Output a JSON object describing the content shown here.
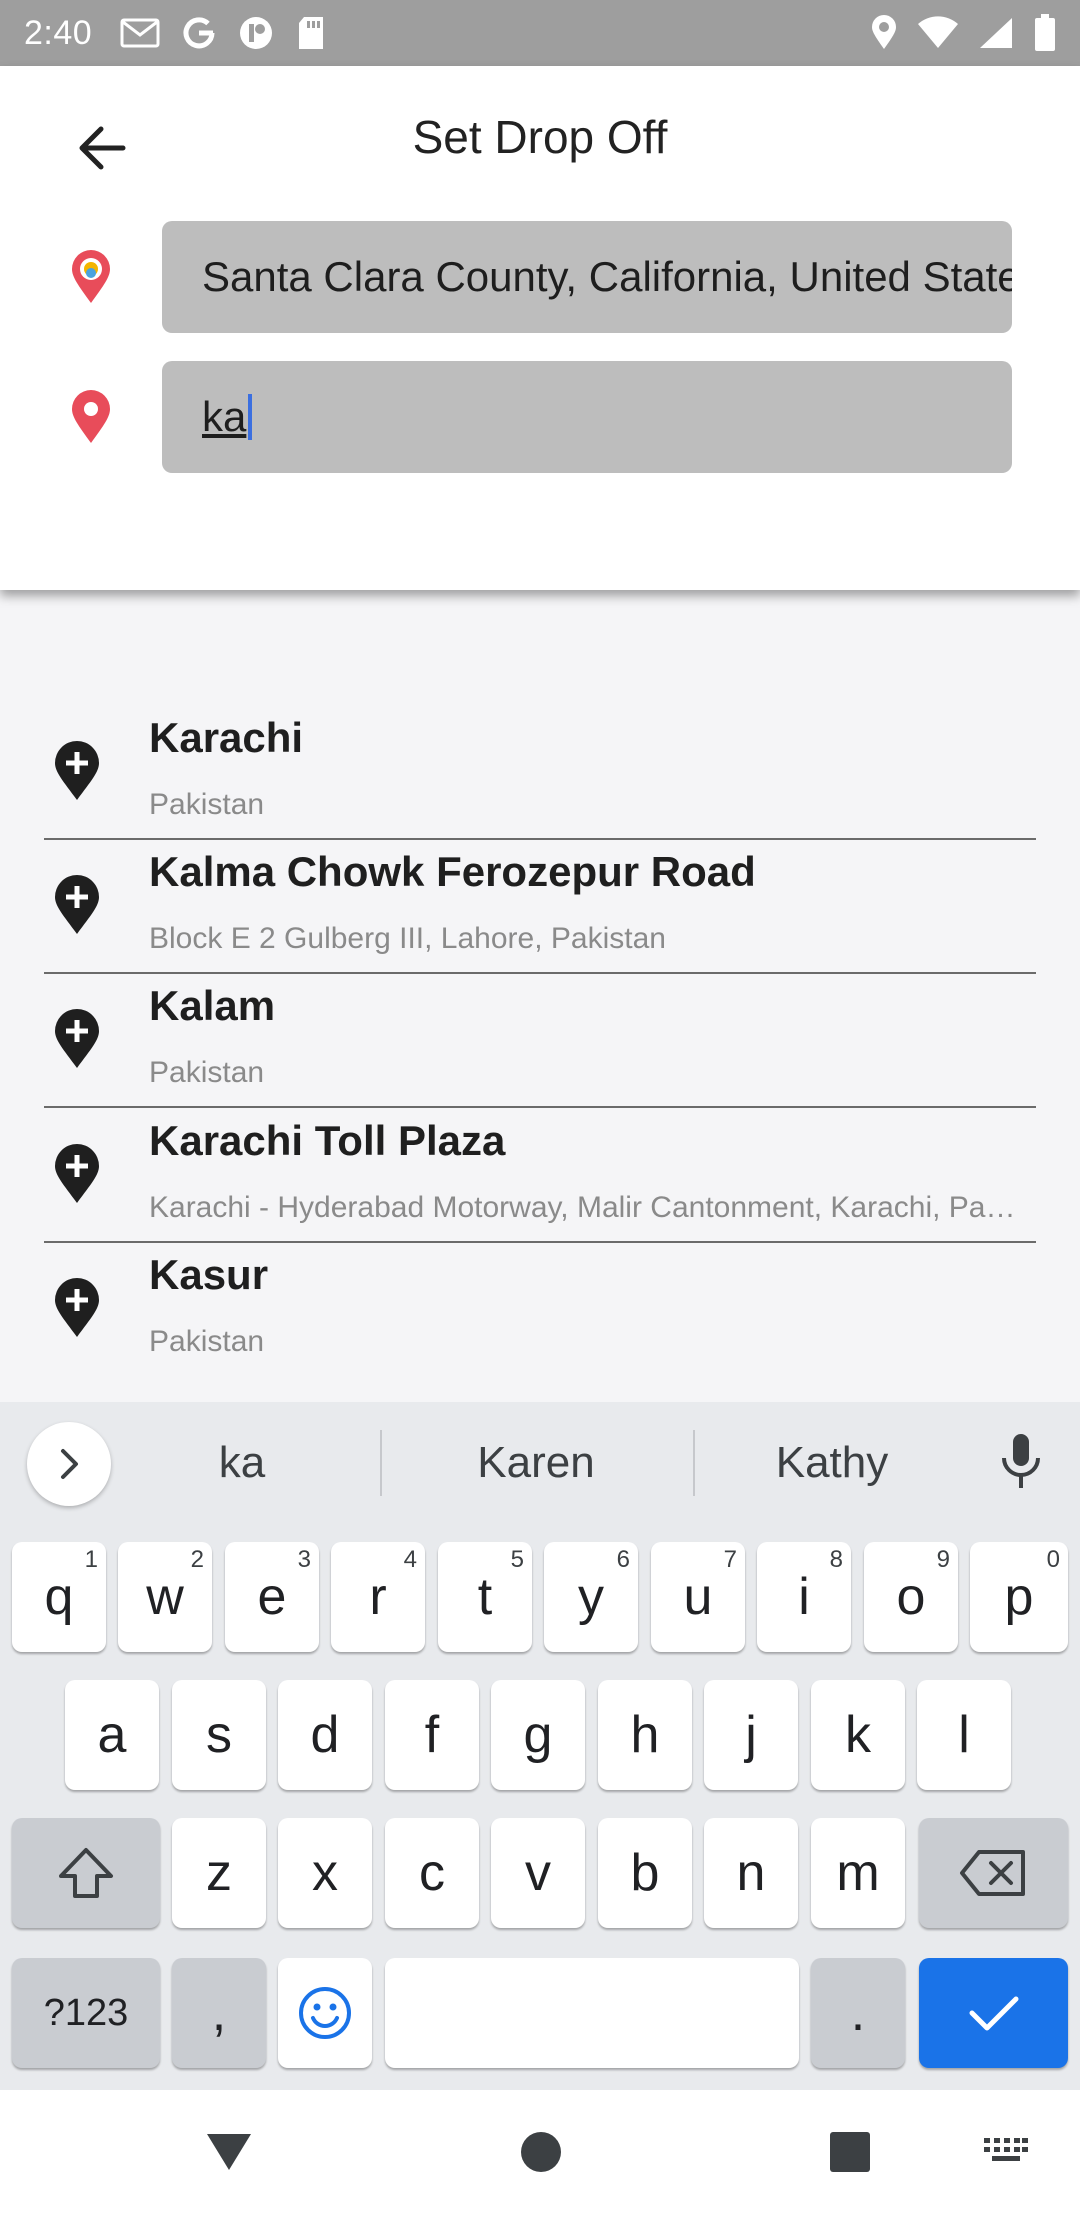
{
  "status_bar": {
    "time": "2:40",
    "left_icons": [
      "gmail-icon",
      "google-icon",
      "app-icon",
      "sd-card-icon"
    ],
    "right_icons": [
      "location-icon",
      "wifi-icon",
      "signal-icon",
      "battery-icon"
    ]
  },
  "header": {
    "title": "Set Drop Off",
    "pickup": {
      "value": "Santa Clara County, California, United States",
      "icon": "pickup-pin-icon"
    },
    "dropoff": {
      "value": "ka",
      "icon": "dropoff-pin-icon"
    }
  },
  "results": [
    {
      "name": "Karachi",
      "sub": "Pakistan"
    },
    {
      "name": "Kalma Chowk Ferozepur Road",
      "sub": "Block E 2 Gulberg III, Lahore, Pakistan"
    },
    {
      "name": "Kalam",
      "sub": "Pakistan"
    },
    {
      "name": "Karachi Toll Plaza",
      "sub": "Karachi - Hyderabad Motorway, Malir Cantonment, Karachi, Pakistan"
    },
    {
      "name": "Kasur",
      "sub": "Pakistan"
    }
  ],
  "keyboard": {
    "suggestions": [
      "ka",
      "Karen",
      "Kathy"
    ],
    "row1": [
      {
        "k": "q",
        "s": "1"
      },
      {
        "k": "w",
        "s": "2"
      },
      {
        "k": "e",
        "s": "3"
      },
      {
        "k": "r",
        "s": "4"
      },
      {
        "k": "t",
        "s": "5"
      },
      {
        "k": "y",
        "s": "6"
      },
      {
        "k": "u",
        "s": "7"
      },
      {
        "k": "i",
        "s": "8"
      },
      {
        "k": "o",
        "s": "9"
      },
      {
        "k": "p",
        "s": "0"
      }
    ],
    "row2": [
      "a",
      "s",
      "d",
      "f",
      "g",
      "h",
      "j",
      "k",
      "l"
    ],
    "row3": [
      "z",
      "x",
      "c",
      "v",
      "b",
      "n",
      "m"
    ],
    "symbols_label": "?123",
    "comma": ",",
    "period": "."
  },
  "colors": {
    "accent": "#1a73e8",
    "pin_red": "#e84c5a",
    "field_bg": "#bdbdbd"
  }
}
